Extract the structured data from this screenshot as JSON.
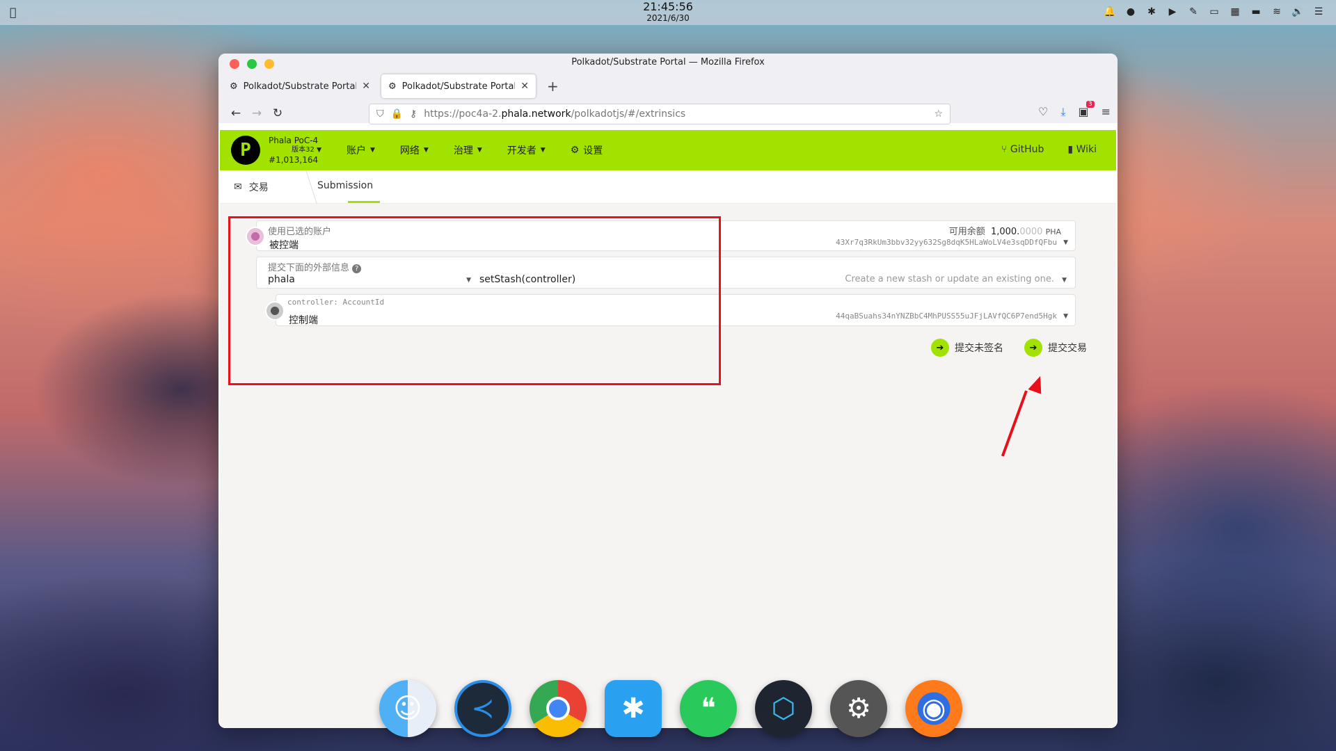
{
  "menubar": {
    "time": "21:45:56",
    "date": "2021/6/30"
  },
  "window": {
    "title": "Polkadot/Substrate Portal — Mozilla Firefox"
  },
  "tabs": [
    {
      "label": "Polkadot/Substrate Portal"
    },
    {
      "label": "Polkadot/Substrate Portal"
    }
  ],
  "url": {
    "prefix": "https://poc4a-2.",
    "domain": "phala.network",
    "path": "/polkadotjs/#/extrinsics"
  },
  "extensions": {
    "badge": "3"
  },
  "app": {
    "chain_name": "Phala PoC-4",
    "version": "版本32",
    "block": "#1,013,164",
    "menu": [
      "账户",
      "网络",
      "治理",
      "开发者",
      "设置"
    ],
    "right": [
      "GitHub",
      "Wiki"
    ]
  },
  "subnav": {
    "crumb": "交易",
    "tab": "Submission"
  },
  "form": {
    "account_label": "使用已选的账户",
    "account_name": "被控端",
    "balance_label": "可用余额",
    "balance_int": "1,000.",
    "balance_dec": "0000",
    "balance_unit": "PHA",
    "account_address": "43Xr7q3RkUm3bbv32yy632Sg8dqK5HLaWoLV4e3sqDDfQFbu",
    "extrinsic_label": "提交下面的外部信息",
    "module": "phala",
    "method": "setStash(controller)",
    "method_desc": "Create a new stash or update an existing one.",
    "param_label": "controller: AccountId",
    "param_name": "控制端",
    "param_address": "44qaBSuahs34nYNZBbC4MhPUSS55uJFjLAVfQC6P7end5Hgk",
    "btn_unsigned": "提交未签名",
    "btn_submit": "提交交易"
  },
  "colors": {
    "accent": "#a2e200",
    "annotation": "#e8101a"
  }
}
